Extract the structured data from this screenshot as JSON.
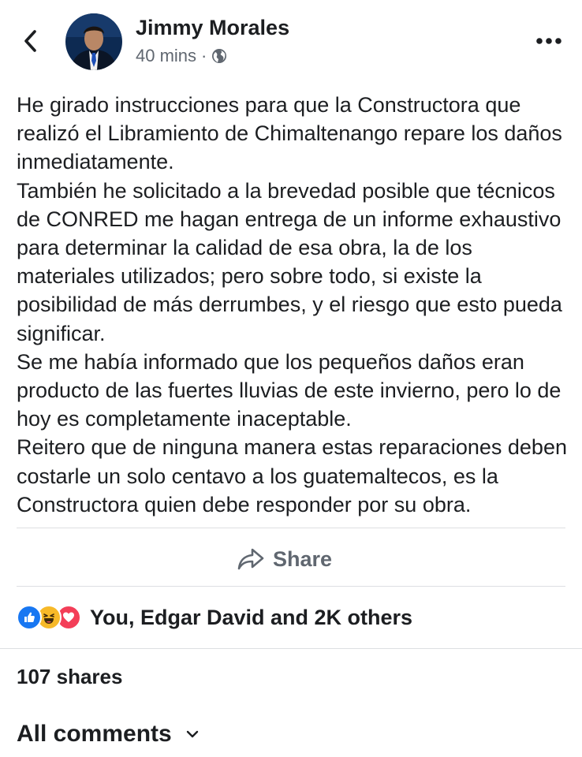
{
  "header": {
    "author_name": "Jimmy Morales",
    "time": "40 mins",
    "separator": "·",
    "privacy_icon": "globe-icon",
    "back_icon": "chevron-left-icon",
    "more_icon": "more-horizontal-icon"
  },
  "post": {
    "paragraphs": [
      "He girado instrucciones para que la Constructora que realizó el Libramiento de Chimaltenango repare los daños inmediatamente.",
      "También he solicitado a la brevedad posible que técnicos de CONRED me hagan entrega de un informe exhaustivo para determinar la calidad de esa obra, la de los materiales utilizados; pero sobre todo, si existe la posibilidad de más derrumbes, y el riesgo que esto pueda significar.",
      "Se me había informado que los pequeños daños eran producto de las fuertes lluvias de este invierno, pero lo de hoy es completamente inaceptable.",
      "Reitero que de ninguna manera estas reparaciones deben costarle un solo centavo a los guatemaltecos, es la Constructora quien debe responder por su obra."
    ]
  },
  "actions": {
    "share_label": "Share",
    "share_icon": "share-arrow-icon"
  },
  "reactions": {
    "icons": [
      "like-icon",
      "haha-icon",
      "love-icon"
    ],
    "label": "You, Edgar David and 2K others"
  },
  "shares": {
    "label": "107 shares"
  },
  "comments": {
    "label": "All comments",
    "icon": "chevron-down-icon"
  },
  "colors": {
    "text": "#1c1e21",
    "secondary": "#606770",
    "divider": "#dddfe2",
    "like_blue": "#1877f2",
    "haha_yellow": "#f7b928",
    "love_red": "#f33e58"
  }
}
